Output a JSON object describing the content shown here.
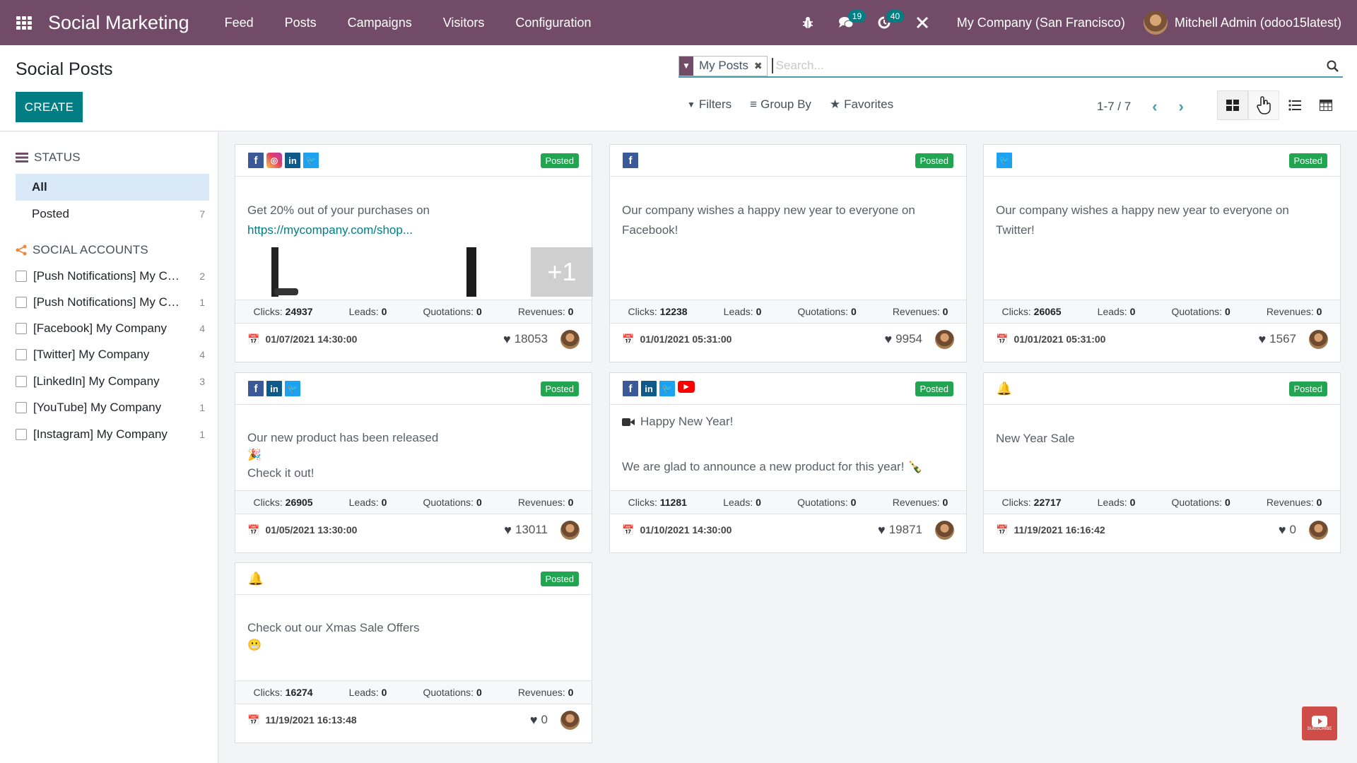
{
  "navbar": {
    "app_name": "Social Marketing",
    "menu": [
      "Feed",
      "Posts",
      "Campaigns",
      "Visitors",
      "Configuration"
    ],
    "icons": [
      "bug-icon",
      "chat-icon",
      "activity-clock-icon",
      "tools-icon"
    ],
    "messages_badge": "19",
    "activities_badge": "40",
    "company": "My Company (San Francisco)",
    "user": "Mitchell Admin (odoo15latest)"
  },
  "control_panel": {
    "title": "Social Posts",
    "create_label": "CREATE",
    "facet_label": "My Posts",
    "search_placeholder": "Search...",
    "filters_label": "Filters",
    "groupby_label": "Group By",
    "favorites_label": "Favorites",
    "pager": "1-7 / 7",
    "views": [
      "kanban",
      "calendar",
      "list",
      "pivot"
    ],
    "active_view": "kanban"
  },
  "sidebar": {
    "status_title": "STATUS",
    "status_items": [
      {
        "label": "All",
        "count": "",
        "active": true
      },
      {
        "label": "Posted",
        "count": "7",
        "active": false
      }
    ],
    "accounts_title": "SOCIAL ACCOUNTS",
    "accounts": [
      {
        "label": "[Push Notifications] My Company",
        "count": "2"
      },
      {
        "label": "[Push Notifications] My Company",
        "count": "1"
      },
      {
        "label": "[Facebook] My Company",
        "count": "4"
      },
      {
        "label": "[Twitter] My Company",
        "count": "4"
      },
      {
        "label": "[LinkedIn] My Company",
        "count": "3"
      },
      {
        "label": "[YouTube] My Company",
        "count": "1"
      },
      {
        "label": "[Instagram] My Company",
        "count": "1"
      }
    ]
  },
  "stat_labels": {
    "clicks": "Clicks: ",
    "leads": "Leads: ",
    "quotations": "Quotations: ",
    "revenues": "Revenues: "
  },
  "posts": [
    {
      "networks": [
        "facebook",
        "instagram",
        "linkedin",
        "twitter"
      ],
      "status": "Posted",
      "line1": "Get 20% out of your purchases on",
      "link": "https://mycompany.com/shop...",
      "more_images": "+1",
      "clicks": "24937",
      "leads": "0",
      "quotations": "0",
      "revenues": "0",
      "date": "01/07/2021 14:30:00",
      "likes": "18053"
    },
    {
      "networks": [
        "facebook"
      ],
      "status": "Posted",
      "line1": "Our company wishes a happy new year to everyone on",
      "line2": "Facebook!",
      "clicks": "12238",
      "leads": "0",
      "quotations": "0",
      "revenues": "0",
      "date": "01/01/2021 05:31:00",
      "likes": "9954"
    },
    {
      "networks": [
        "twitter"
      ],
      "status": "Posted",
      "line1": "Our company wishes a happy new year to everyone on",
      "line2": "Twitter!",
      "clicks": "26065",
      "leads": "0",
      "quotations": "0",
      "revenues": "0",
      "date": "01/01/2021 05:31:00",
      "likes": "1567"
    },
    {
      "networks": [
        "facebook",
        "linkedin",
        "twitter"
      ],
      "status": "Posted",
      "line1": "Our new product has been released",
      "emoji": "🎉",
      "line2": "Check it out!",
      "clicks": "26905",
      "leads": "0",
      "quotations": "0",
      "revenues": "0",
      "date": "01/05/2021 13:30:00",
      "likes": "13011"
    },
    {
      "networks": [
        "facebook",
        "linkedin",
        "twitter",
        "youtube"
      ],
      "status": "Posted",
      "video_title": "Happy New Year!",
      "line1": "We are glad to announce a new product for this year! 🍾",
      "clicks": "11281",
      "leads": "0",
      "quotations": "0",
      "revenues": "0",
      "date": "01/10/2021 14:30:00",
      "likes": "19871"
    },
    {
      "networks": [
        "push"
      ],
      "status": "Posted",
      "line1": "New Year Sale",
      "clicks": "22717",
      "leads": "0",
      "quotations": "0",
      "revenues": "0",
      "date": "11/19/2021 16:16:42",
      "likes": "0"
    },
    {
      "networks": [
        "push"
      ],
      "status": "Posted",
      "line1": "Check out our Xmas Sale Offers",
      "emoji": "😬",
      "clicks": "16274",
      "leads": "0",
      "quotations": "0",
      "revenues": "0",
      "date": "11/19/2021 16:13:48",
      "likes": "0"
    }
  ],
  "overlay": {
    "subscribe_label": "SUBSCRIBE"
  }
}
